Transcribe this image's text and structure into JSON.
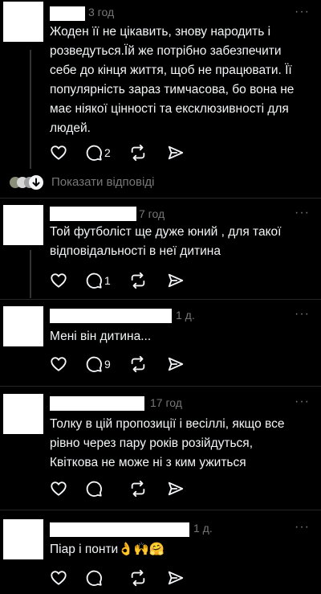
{
  "comments": [
    {
      "time": "3 год",
      "text_lines": [
        "Жоден її не цікавить, знову народить і",
        "розведуться.Їй же потрібно забезпечити",
        "себе до кінця життя, щоб не працювати. Її",
        "популярність зараз тимчасова, бо вона не",
        "має ніякої цінності та ексклюзивності для",
        "людей."
      ],
      "reply_count": "2"
    },
    {
      "time": "7 год",
      "text_lines": [
        "Той футболіст ще дуже юний , для такої",
        "відповідальності в неї дитина"
      ],
      "reply_count": "1"
    },
    {
      "time": "1 д.",
      "text_lines": [
        "Мені він дитина..."
      ],
      "reply_count": "9"
    },
    {
      "time": "17 год",
      "text_lines": [
        "Толку в цій пропозиції і весіллі, якщо все",
        "рівно через пару років розійдуться,",
        "Квіткова не може ні з ким ужиться"
      ],
      "reply_count": ""
    },
    {
      "time": "1 д.",
      "text_lines": [
        "Піар і понти👌🙌🤗"
      ],
      "reply_count": ""
    }
  ],
  "show_replies_label": "Показати відповіді",
  "more_label": "···",
  "icons": {
    "like": "heart-icon",
    "reply": "comment-bubble-icon",
    "repost": "repost-icon",
    "share": "send-icon"
  },
  "colors": {
    "background": "#000000",
    "text": "#f3f5f7",
    "muted": "#777777"
  }
}
